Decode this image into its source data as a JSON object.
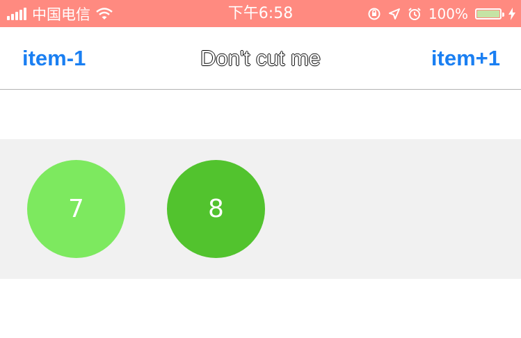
{
  "status_bar": {
    "carrier": "中国电信",
    "time": "下午6:58",
    "battery_text": "100%",
    "battery_level": 1.0,
    "icons": [
      "signal-bars-icon",
      "wifi-icon",
      "orientation-lock-icon",
      "location-arrow-icon",
      "alarm-clock-icon",
      "battery-icon",
      "charging-bolt-icon"
    ],
    "bg_color": "#ff8a80"
  },
  "nav": {
    "left_label": "item-1",
    "title": "Don't cut me",
    "right_label": "item+1",
    "accent": "#1a7ff2"
  },
  "items": [
    {
      "label": "7",
      "color": "#7de95f"
    },
    {
      "label": "8",
      "color": "#52c32e"
    }
  ],
  "band_color": "#f1f1f1"
}
